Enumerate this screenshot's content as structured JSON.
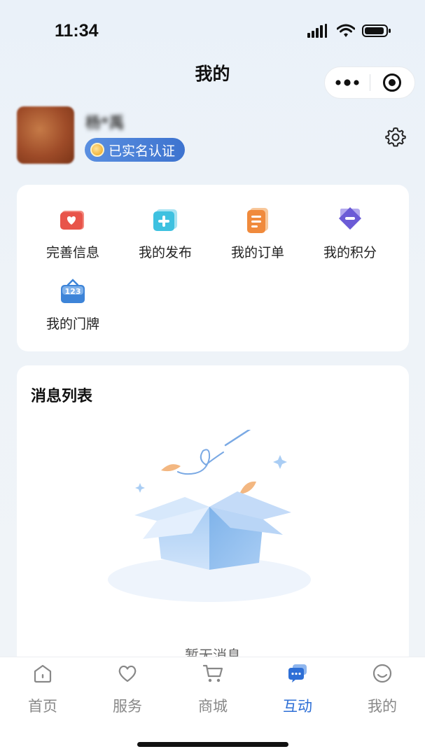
{
  "status_bar": {
    "time": "11:34"
  },
  "nav": {
    "title": "我的",
    "more_icon": "more-dots-icon",
    "close_icon": "target-icon"
  },
  "profile": {
    "username": "杨*禹",
    "verify_badge": "已实名认证",
    "settings_icon": "gear-icon"
  },
  "quick_actions": [
    {
      "label": "完善信息",
      "icon": "profile-heart-icon",
      "color": "#e8544a"
    },
    {
      "label": "我的发布",
      "icon": "publish-plus-icon",
      "color": "#3ec1e0"
    },
    {
      "label": "我的订单",
      "icon": "order-list-icon",
      "color": "#f08a3c"
    },
    {
      "label": "我的积分",
      "icon": "points-tag-icon",
      "color": "#6b5bd6"
    },
    {
      "label": "我的门牌",
      "icon": "house-number-icon",
      "color": "#3d84d8"
    }
  ],
  "messages": {
    "title": "消息列表",
    "empty_text": "暂无消息",
    "empty_icon": "empty-box-illustration"
  },
  "tabbar": {
    "active": "互动",
    "tabs": [
      {
        "label": "首页",
        "icon": "home-icon"
      },
      {
        "label": "服务",
        "icon": "heart-icon"
      },
      {
        "label": "商城",
        "icon": "cart-icon"
      },
      {
        "label": "互动",
        "icon": "chat-icon"
      },
      {
        "label": "我的",
        "icon": "profile-circle-icon"
      }
    ]
  },
  "colors": {
    "accent": "#2e6fd6",
    "badge": "#3d73cf",
    "background": "#eaf1f9"
  }
}
